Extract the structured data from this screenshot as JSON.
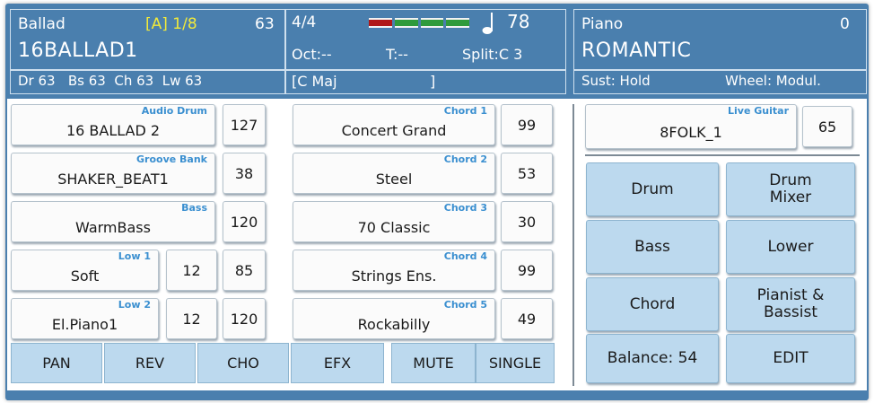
{
  "header": {
    "style_category": "Ballad",
    "variation": "[A] 1/8",
    "style_number": "63",
    "style_name": "16BALLAD1",
    "track_volumes": "Dr 63   Bs 63  Ch 63  Lw 63",
    "time_signature": "4/4",
    "octave": "Oct:--",
    "transpose": "T:--",
    "split": "Split:C 3",
    "tempo": "78",
    "chord": "[C Maj",
    "chord_close": "]",
    "voice_category": "Piano",
    "voice_number": "0",
    "voice_name": "ROMANTIC",
    "sustain": "Sust: Hold",
    "wheel": "Wheel: Modul.",
    "meter_colors": [
      "#b01818",
      "#2f9a3c",
      "#2f9a3c",
      "#2f9a3c"
    ]
  },
  "tracks_left": [
    {
      "tag": "Audio Drum",
      "name": "16 BALLAD 2",
      "value": "127"
    },
    {
      "tag": "Groove Bank",
      "name": "SHAKER_BEAT1",
      "value": "38"
    },
    {
      "tag": "Bass",
      "name": "WarmBass",
      "value": "120"
    },
    {
      "tag": "Low 1",
      "name": "Soft",
      "octave": "12",
      "value": "85"
    },
    {
      "tag": "Low 2",
      "name": "El.Piano1",
      "octave": "12",
      "value": "120"
    }
  ],
  "tracks_mid": [
    {
      "tag": "Chord 1",
      "name": "Concert Grand",
      "value": "99"
    },
    {
      "tag": "Chord 2",
      "name": "Steel",
      "value": "53"
    },
    {
      "tag": "Chord 3",
      "name": "70 Classic",
      "value": "30"
    },
    {
      "tag": "Chord 4",
      "name": "Strings Ens.",
      "value": "99"
    },
    {
      "tag": "Chord 5",
      "name": "Rockabilly",
      "value": "49"
    }
  ],
  "live": {
    "tag": "Live Guitar",
    "name": "8FOLK_1",
    "value": "65"
  },
  "right_buttons": {
    "drum": "Drum",
    "drum_mixer_1": "Drum",
    "drum_mixer_2": "Mixer",
    "bass": "Bass",
    "lower": "Lower",
    "chord": "Chord",
    "pianist_1": "Pianist &",
    "pianist_2": "Bassist",
    "balance": "Balance: 54",
    "edit": "EDIT"
  },
  "bottom_buttons": {
    "pan": "PAN",
    "rev": "REV",
    "cho": "CHO",
    "efx": "EFX",
    "mute": "MUTE",
    "single": "SINGLE"
  },
  "colors": {
    "header_bg": "#4a7fae",
    "accent_yellow": "#f2ea3a",
    "button_blue": "#bcd9ee",
    "tag_blue": "#3a8fd0"
  }
}
